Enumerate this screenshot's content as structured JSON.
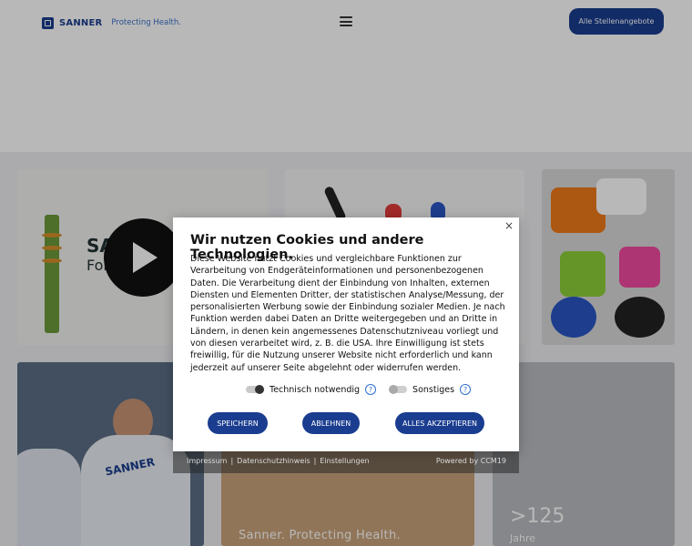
{
  "header": {
    "brand": "SANNER",
    "tagline": "Protecting Health.",
    "jobs_button": "Alle Stellenangebote"
  },
  "cards": {
    "video_title": "SANNER B",
    "video_subtitle": "For the Pro",
    "team_print": "SANNER",
    "claim": "Sanner. Protecting Health.",
    "years_value": ">125",
    "years_label": "Jahre"
  },
  "cookie_dialog": {
    "close": "×",
    "title": "Wir nutzen Cookies und andere Technologien.",
    "text": "Diese Website nutzt Cookies und vergleichbare Funktionen zur Verarbeitung von Endgeräteinformationen und personenbezogenen Daten. Die Verarbeitung dient der Einbindung von Inhalten, externen Diensten und Elementen Dritter, der statistischen Analyse/Messung, der personalisierten Werbung sowie der Einbindung sozialer Medien. Je nach Funktion werden dabei Daten an Dritte weitergegeben und an Dritte in Ländern, in denen kein angemessenes Datenschutzniveau vorliegt und von diesen verarbeitet wird, z. B. die USA. Ihre Einwilligung ist stets freiwillig, für die Nutzung unserer Website nicht erforderlich und kann jederzeit auf unserer Seite abgelehnt oder widerrufen werden.",
    "options": [
      {
        "label": "Technisch notwendig",
        "enabled": true
      },
      {
        "label": "Sonstiges",
        "enabled": false
      }
    ],
    "help_glyph": "?",
    "buttons": {
      "save": "SPEICHERN",
      "reject": "ABLEHNEN",
      "accept": "ALLES AKZEPTIEREN"
    },
    "footer_links": [
      "Impressum",
      "|",
      "Datenschutzhinweis",
      "|",
      "Einstellungen"
    ],
    "powered_by": "Powered by CCM19"
  },
  "colors": {
    "brand_blue": "#1a3d8f",
    "link_blue": "#2e6fd1"
  }
}
